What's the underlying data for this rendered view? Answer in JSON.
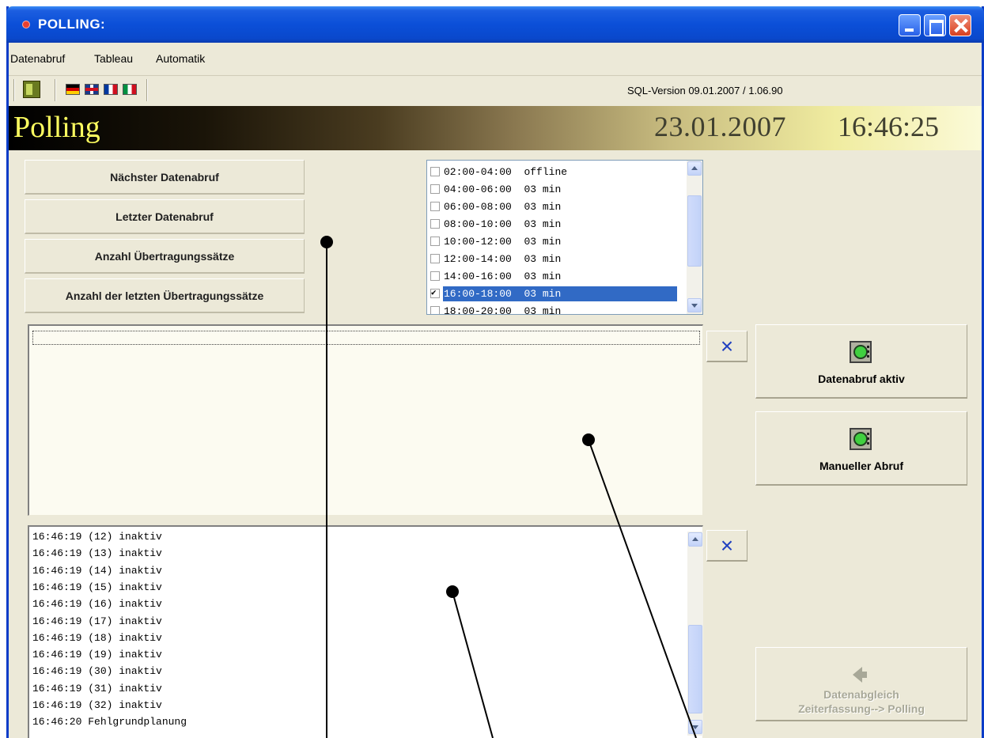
{
  "window": {
    "title": "POLLING:"
  },
  "menu": [
    "Datenabruf",
    "Tableau",
    "Automatik"
  ],
  "toolbar": {
    "icons": [
      "exit-icon",
      "flag-de-icon",
      "flag-uk-icon",
      "flag-fr-icon",
      "flag-it-icon"
    ],
    "sql_version": "SQL-Version 09.01.2007 / 1.06.90"
  },
  "banner": {
    "title": "Polling",
    "date": "23.01.2007",
    "time": "16:46:25"
  },
  "info_buttons": [
    "Nächster Datenabruf",
    "Letzter Datenabruf",
    "Anzahl Übertragungssätze",
    "Anzahl der letzten Übertragungssätze"
  ],
  "schedule": [
    {
      "time": "02:00-04:00",
      "interval": "offline",
      "checked": false,
      "selected": false
    },
    {
      "time": "04:00-06:00",
      "interval": "03 min",
      "checked": false,
      "selected": false
    },
    {
      "time": "06:00-08:00",
      "interval": "03 min",
      "checked": false,
      "selected": false
    },
    {
      "time": "08:00-10:00",
      "interval": "03 min",
      "checked": false,
      "selected": false
    },
    {
      "time": "10:00-12:00",
      "interval": "03 min",
      "checked": false,
      "selected": false
    },
    {
      "time": "12:00-14:00",
      "interval": "03 min",
      "checked": false,
      "selected": false
    },
    {
      "time": "14:00-16:00",
      "interval": "03 min",
      "checked": false,
      "selected": false
    },
    {
      "time": "16:00-18:00",
      "interval": "03 min",
      "checked": true,
      "selected": true
    },
    {
      "time": "18:00-20:00",
      "interval": "03 min",
      "checked": false,
      "selected": false
    }
  ],
  "buttons": {
    "clear_symbol": "×",
    "datenabruf_aktiv": "Datenabruf aktiv",
    "manueller_abruf": "Manueller Abruf",
    "datenabgleich_line1": "Datenabgleich",
    "datenabgleich_line2": "Zeiterfassung--> Polling"
  },
  "log": [
    "16:46:19 (12) inaktiv",
    "16:46:19 (13) inaktiv",
    "16:46:19 (14) inaktiv",
    "16:46:19 (15) inaktiv",
    "16:46:19 (16) inaktiv",
    "16:46:19 (17) inaktiv",
    "16:46:19 (18) inaktiv",
    "16:46:19 (19) inaktiv",
    "16:46:19 (30) inaktiv",
    "16:46:19 (31) inaktiv",
    "16:46:19 (32) inaktiv",
    "16:46:20 Fehlgrundplanung"
  ],
  "colors": {
    "title_bar": "#0b4fd8",
    "selection": "#316ac5",
    "banner_title": "#ffff60",
    "clear_x": "#2040c0"
  }
}
